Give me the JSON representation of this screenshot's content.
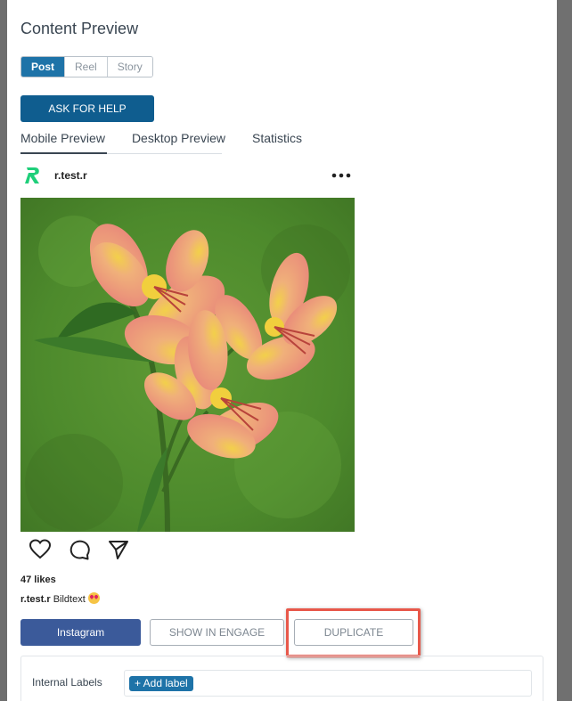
{
  "modal": {
    "title": "Content Preview"
  },
  "post_type_selector": {
    "options": [
      "Post",
      "Reel",
      "Story"
    ],
    "selected": "Post"
  },
  "help_button": {
    "label": "ASK FOR HELP"
  },
  "preview_tabs": {
    "items": [
      "Mobile Preview",
      "Desktop Preview",
      "Statistics"
    ],
    "active": "Mobile Preview"
  },
  "post": {
    "username": "r.test.r",
    "image_description_icon": "flower-photo",
    "likes": "47 likes",
    "caption_user": "r.test.r",
    "caption_text": "Bildtext"
  },
  "action_buttons": {
    "instagram": "Instagram",
    "engage": "SHOW IN ENGAGE",
    "duplicate": "DUPLICATE"
  },
  "labels": {
    "title": "Internal Labels",
    "add_label": "+ Add label"
  },
  "colors": {
    "primary": "#1e73a8",
    "help_button": "#0f5d8f",
    "instagram_button": "#3b5a9a",
    "highlight": "#e8584a",
    "avatar_green": "#1fcf7a"
  }
}
